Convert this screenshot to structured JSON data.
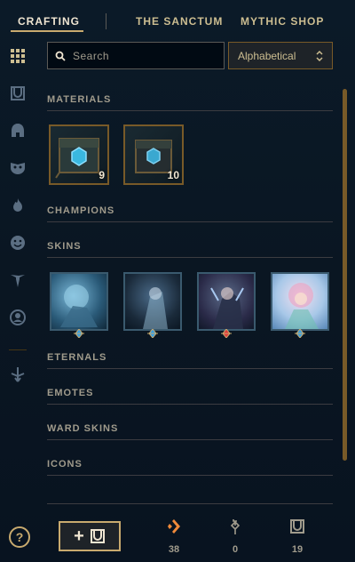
{
  "nav": {
    "tabs": [
      {
        "label": "CRAFTING",
        "active": true
      },
      {
        "label": "THE SANCTUM",
        "active": false
      },
      {
        "label": "MYTHIC SHOP",
        "active": false
      }
    ]
  },
  "sidebar": {
    "icons": [
      "grid-icon",
      "chest-icon",
      "helmet-icon",
      "mask-icon",
      "flame-icon",
      "emote-face-icon",
      "ward-icon",
      "profile-icon-icon",
      "eternals-arrows-icon"
    ]
  },
  "search": {
    "placeholder": "Search",
    "value": ""
  },
  "sort": {
    "label": "Alphabetical",
    "icon": "chevron-updown-icon"
  },
  "sections": {
    "materials": "MATERIALS",
    "champions": "CHAMPIONS",
    "skins": "SKINS",
    "eternals": "ETERNALS",
    "emotes": "EMOTES",
    "ward_skins": "WARD SKINS",
    "icons": "ICONS"
  },
  "materials": [
    {
      "name": "hextech-chest",
      "count": "9"
    },
    {
      "name": "masterwork-chest",
      "count": "10"
    }
  ],
  "skins": [
    {
      "rarity": "epic",
      "gem_color": "#3a9fe0"
    },
    {
      "rarity": "epic",
      "gem_color": "#3a9fe0"
    },
    {
      "rarity": "legendary",
      "gem_color": "#e03a3a"
    },
    {
      "rarity": "epic",
      "gem_color": "#3a9fe0"
    }
  ],
  "footer": {
    "help_label": "?",
    "add_label": "+",
    "currencies": [
      {
        "icon": "orange-essence-icon",
        "value": "38",
        "color": "#f08a3a"
      },
      {
        "icon": "key-icon",
        "value": "0",
        "color": "#a09b8c"
      },
      {
        "icon": "chest-icon",
        "value": "19",
        "color": "#a09b8c"
      }
    ]
  },
  "colors": {
    "gold": "#c8aa6e",
    "text": "#a09b8c",
    "bg": "#0a1622"
  }
}
